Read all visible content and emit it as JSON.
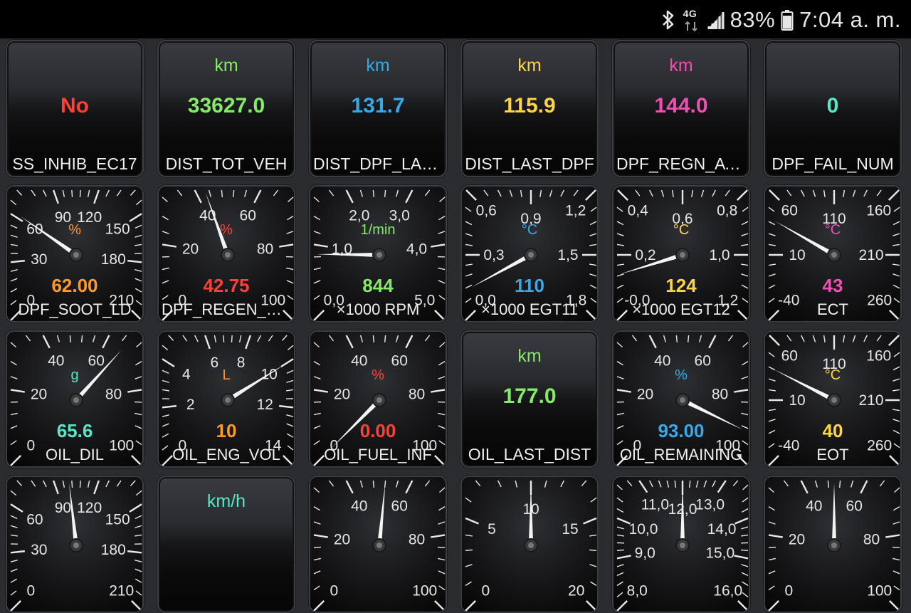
{
  "status_bar": {
    "battery": "83%",
    "time": "7:04 a. m.",
    "network": "4G"
  },
  "colors": {
    "red": "#ff4036",
    "green": "#84ea68",
    "blue": "#39a8e6",
    "yellow": "#ffd445",
    "pink": "#ee4fb2",
    "teal": "#58e6c7",
    "orange": "#ff9a26",
    "white": "#f0f0f0"
  },
  "tiles": [
    {
      "type": "text",
      "unit": "",
      "value": "No",
      "label": "SS_INHIB_EC17",
      "color": "#ff4036"
    },
    {
      "type": "text",
      "unit": "km",
      "value": "33627.0",
      "label": "DIST_TOT_VEH",
      "color": "#84ea68"
    },
    {
      "type": "text",
      "unit": "km",
      "value": "131.7",
      "label": "DIST_DPF_LAS…",
      "color": "#39a8e6"
    },
    {
      "type": "text",
      "unit": "km",
      "value": "115.9",
      "label": "DIST_LAST_DPF",
      "color": "#ffd445"
    },
    {
      "type": "text",
      "unit": "km",
      "value": "144.0",
      "label": "DPF_REGN_AV…",
      "color": "#ee4fb2"
    },
    {
      "type": "text",
      "unit": "",
      "value": "0",
      "label": "DPF_FAIL_NUM",
      "color": "#58e6c7"
    },
    {
      "type": "gauge",
      "unit": "%",
      "value": "62.00",
      "label": "DPF_SOOT_LD",
      "color": "#ff9a26",
      "ticks": [
        "0",
        "30",
        "60",
        "90",
        "120",
        "150",
        "180",
        "210"
      ],
      "reading": 62
    },
    {
      "type": "gauge",
      "unit": "%",
      "value": "42.75",
      "label": "DPF_REGEN_P…",
      "color": "#ff4036",
      "ticks": [
        "0",
        "20",
        "40",
        "60",
        "80",
        "100"
      ],
      "reading": 42.75
    },
    {
      "type": "gauge",
      "unit": "1/min",
      "value": "844",
      "label": "×1000 RPM",
      "color": "#84ea68",
      "ticks": [
        "0,0",
        "1,0",
        "2,0",
        "3,0",
        "4,0",
        "5,0"
      ],
      "reading": 0.844
    },
    {
      "type": "gauge",
      "unit": "°C",
      "value": "110",
      "label": "×1000 EGT11",
      "color": "#39a8e6",
      "ticks": [
        "0,0",
        "0,3",
        "0,6",
        "0,9",
        "1,2",
        "1,5",
        "1,8"
      ],
      "reading": 0.11
    },
    {
      "type": "gauge",
      "unit": "°C",
      "value": "124",
      "label": "×1000 EGT12",
      "color": "#ffd445",
      "ticks": [
        "-0,0",
        "0,2",
        "0,4",
        "0,6",
        "0,8",
        "1,0",
        "1,2"
      ],
      "reading": 0.124
    },
    {
      "type": "gauge",
      "unit": "°C",
      "value": "43",
      "label": "ECT",
      "color": "#ee4fb2",
      "ticks": [
        "-40",
        "10",
        "60",
        "110",
        "160",
        "210",
        "260"
      ],
      "reading": 43
    },
    {
      "type": "gauge",
      "unit": "g",
      "value": "65.6",
      "label": "OIL_DIL",
      "color": "#58e6c7",
      "ticks": [
        "0",
        "20",
        "40",
        "60",
        "80",
        "100"
      ],
      "reading": 65.6
    },
    {
      "type": "gauge",
      "unit": "L",
      "value": "10",
      "label": "OIL_ENG_VOL",
      "color": "#ff9a26",
      "ticks": [
        "0",
        "2",
        "4",
        "6",
        "8",
        "10",
        "12",
        "14"
      ],
      "reading": 10
    },
    {
      "type": "gauge",
      "unit": "%",
      "value": "0.00",
      "label": "OIL_FUEL_INF",
      "color": "#ff4036",
      "ticks": [
        "0",
        "20",
        "40",
        "60",
        "80",
        "100"
      ],
      "reading": 0
    },
    {
      "type": "text",
      "unit": "km",
      "value": "177.0",
      "label": "OIL_LAST_DIST",
      "color": "#84ea68"
    },
    {
      "type": "gauge",
      "unit": "%",
      "value": "93.00",
      "label": "OIL_REMAINING",
      "color": "#39a8e6",
      "ticks": [
        "0",
        "20",
        "40",
        "60",
        "80",
        "100"
      ],
      "reading": 93
    },
    {
      "type": "gauge",
      "unit": "°C",
      "value": "40",
      "label": "EOT",
      "color": "#ffd445",
      "ticks": [
        "-40",
        "10",
        "60",
        "110",
        "160",
        "210",
        "260"
      ],
      "reading": 40
    },
    {
      "type": "gauge",
      "unit": "",
      "value": "",
      "label": "",
      "color": "#ff9a26",
      "ticks": [
        "0",
        "30",
        "60",
        "90",
        "120",
        "150",
        "180",
        "210"
      ],
      "reading": 100
    },
    {
      "type": "text",
      "unit": "km/h",
      "value": "",
      "label": "",
      "color": "#58e6c7"
    },
    {
      "type": "gauge",
      "unit": "",
      "value": "",
      "label": "",
      "color": "#ff4036",
      "ticks": [
        "0",
        "20",
        "40",
        "60",
        "80",
        "100"
      ],
      "reading": 52
    },
    {
      "type": "gauge",
      "unit": "",
      "value": "",
      "label": "",
      "color": "#84ea68",
      "ticks": [
        "0",
        "5",
        "10",
        "15",
        "20"
      ],
      "reading": 10
    },
    {
      "type": "gauge",
      "unit": "",
      "value": "",
      "label": "",
      "color": "#39a8e6",
      "ticks": [
        "8,0",
        "9,0",
        "10,0",
        "11,0",
        "12,0",
        "13,0",
        "14,0",
        "15,0",
        "16,0"
      ],
      "reading": 12
    },
    {
      "type": "gauge",
      "unit": "",
      "value": "",
      "label": "",
      "color": "#58e6c7",
      "ticks": [
        "0",
        "20",
        "40",
        "60",
        "80",
        "100"
      ],
      "reading": 50
    }
  ]
}
